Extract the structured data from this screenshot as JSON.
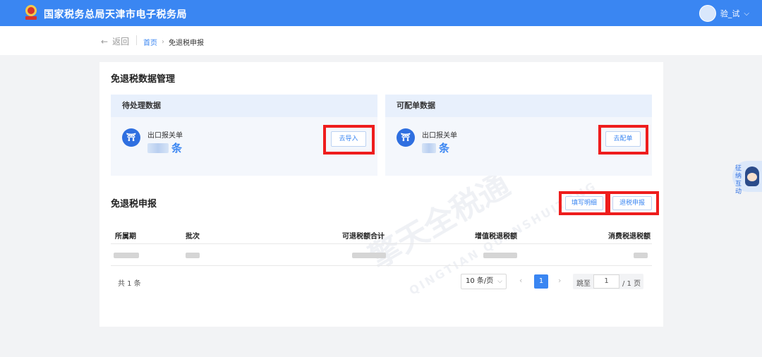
{
  "header": {
    "site_title": "国家税务总局天津市电子税务局",
    "user_name": "验_试",
    "user_caret": "⌵"
  },
  "nav": {
    "back_label": "返回",
    "back_arrow": "←",
    "breadcrumb": [
      "首页",
      "免退税申报"
    ],
    "breadcrumb_sep": "›"
  },
  "data_mgmt": {
    "title": "免退税数据管理",
    "pending": {
      "title": "待处理数据",
      "doc_label": "出口报关单",
      "count_unit": "条",
      "action": "去导入"
    },
    "matchable": {
      "title": "可配单数据",
      "doc_label": "出口报关单",
      "count_unit": "条",
      "action": "去配单"
    }
  },
  "declaration": {
    "title": "免退税申报",
    "buttons": {
      "fill_detail": "填写明细",
      "refund_declare": "退税申报"
    },
    "columns": [
      "所属期",
      "批次",
      "可退税额合计",
      "增值税退税额",
      "消费税退税额"
    ]
  },
  "pagination": {
    "total": "共 1 条",
    "page_size": "10 条/页",
    "prev": "‹",
    "next": "›",
    "current": "1",
    "jump_label": "跳至",
    "jump_value": "1",
    "jump_total": "/ 1 页"
  },
  "watermark": {
    "cn": "擎天全税通",
    "en": "QINGTIAN QUANSHUITONG"
  },
  "float_widget": {
    "text": "征纳互动"
  },
  "colors": {
    "primary": "#3a86f2",
    "highlight": "#ee1d1d",
    "panel_head": "#e8f0fc"
  }
}
